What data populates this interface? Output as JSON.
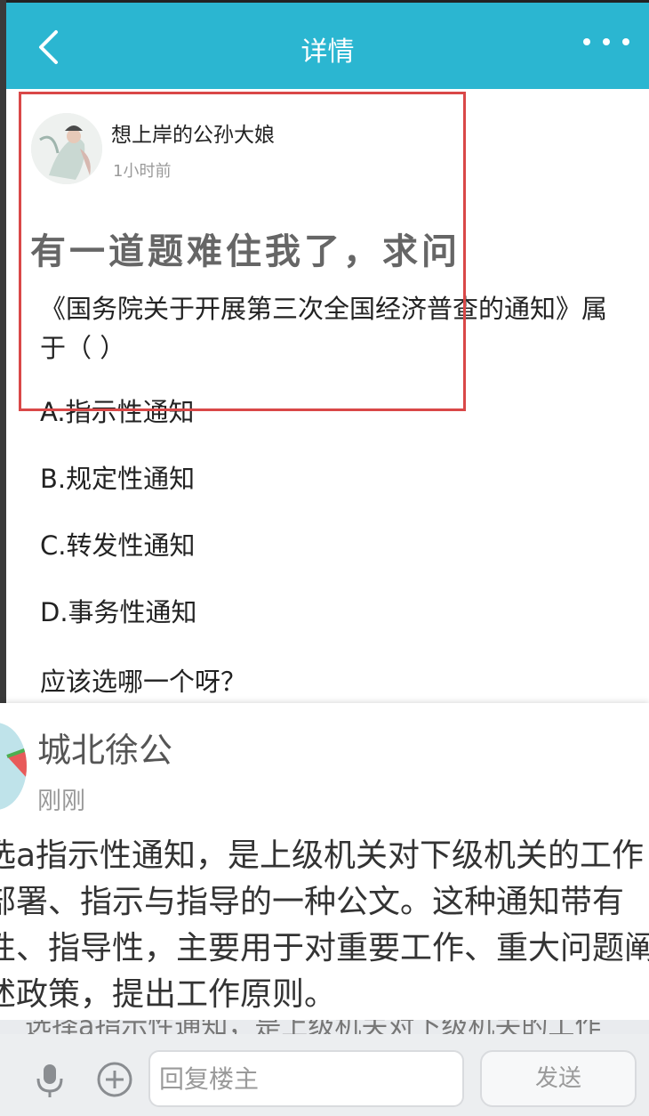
{
  "header": {
    "title": "详情",
    "back_icon": "chevron-left-icon",
    "more_icon": "more-dots-icon",
    "bg_color": "#2bb6d1"
  },
  "post": {
    "username": "想上岸的公孙大娘",
    "time": "1小时前",
    "headline": "有一道题难住我了，求问",
    "question": "《国务院关于开展第三次全国经济普查的通知》属于（ ）",
    "options": [
      "A.指示性通知",
      "B.规定性通知",
      "C.转发性通知",
      "D.事务性通知"
    ],
    "followup": "应该选哪一个呀？",
    "highlight_color": "#d94848"
  },
  "reply": {
    "username": "城北徐公",
    "time": "刚刚",
    "lines": [
      "选a指示性通知，是上级机关对下级机关的工作",
      "部署、指示与指导的一种公文。这种通知带有",
      "性、指导性，主要用于对重要工作、重大问题阐",
      "述政策，提出工作原则。"
    ],
    "underlay_text": "选择a指示性通知，是上级机关对下级机关的工作"
  },
  "bottom_bar": {
    "mic_icon": "microphone-icon",
    "plus_icon": "plus-circle-icon",
    "input_placeholder": "回复楼主",
    "send_label": "发送"
  }
}
